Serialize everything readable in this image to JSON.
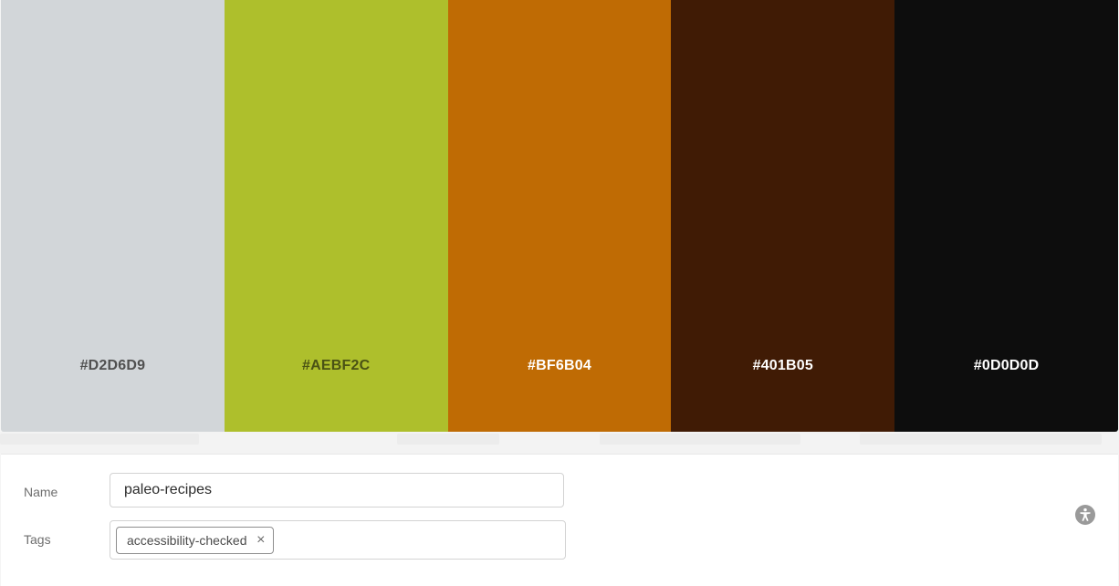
{
  "palette": {
    "swatches": [
      {
        "hex": "#D2D6D9",
        "label": "#D2D6D9",
        "label_color": "#505050"
      },
      {
        "hex": "#AEBF2C",
        "label": "#AEBF2C",
        "label_color": "#4a5214"
      },
      {
        "hex": "#BF6B04",
        "label": "#BF6B04",
        "label_color": "#ffffff"
      },
      {
        "hex": "#401B05",
        "label": "#401B05",
        "label_color": "#ffffff"
      },
      {
        "hex": "#0D0D0D",
        "label": "#0D0D0D",
        "label_color": "#ffffff"
      }
    ]
  },
  "form": {
    "name_label": "Name",
    "name_value": "paleo-recipes",
    "tags_label": "Tags",
    "tags": [
      "accessibility-checked"
    ],
    "tag_remove_glyph": "×"
  },
  "icons": {
    "accessibility": "accessibility-icon",
    "tag_remove": "close-icon"
  }
}
